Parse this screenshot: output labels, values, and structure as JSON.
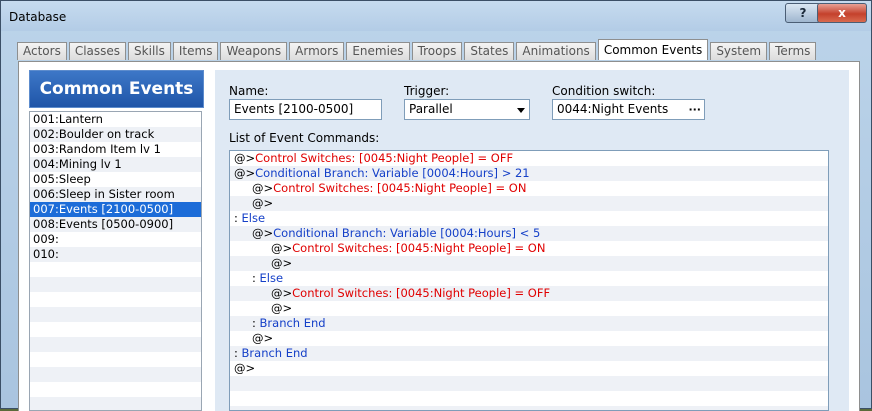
{
  "window": {
    "title": "Database",
    "help_label": "?",
    "close_label": "x"
  },
  "tabs": [
    {
      "label": "Actors"
    },
    {
      "label": "Classes"
    },
    {
      "label": "Skills"
    },
    {
      "label": "Items"
    },
    {
      "label": "Weapons"
    },
    {
      "label": "Armors"
    },
    {
      "label": "Enemies"
    },
    {
      "label": "Troops"
    },
    {
      "label": "States"
    },
    {
      "label": "Animations"
    },
    {
      "label": "Common Events",
      "active": true
    },
    {
      "label": "System"
    },
    {
      "label": "Terms"
    }
  ],
  "sidebar": {
    "header": "Common Events",
    "items": [
      {
        "label": "001:Lantern"
      },
      {
        "label": "002:Boulder on track"
      },
      {
        "label": "003:Random Item lv 1"
      },
      {
        "label": "004:Mining lv 1"
      },
      {
        "label": "005:Sleep"
      },
      {
        "label": "006:Sleep in Sister room"
      },
      {
        "label": "007:Events [2100-0500]",
        "selected": true
      },
      {
        "label": "008:Events [0500-0900]"
      },
      {
        "label": "009:"
      },
      {
        "label": "010:"
      },
      {
        "label": ""
      },
      {
        "label": ""
      },
      {
        "label": ""
      },
      {
        "label": ""
      },
      {
        "label": ""
      },
      {
        "label": ""
      },
      {
        "label": ""
      },
      {
        "label": ""
      },
      {
        "label": ""
      },
      {
        "label": ""
      }
    ]
  },
  "form": {
    "name_label": "Name:",
    "name_value": "Events [2100-0500]",
    "trigger_label": "Trigger:",
    "trigger_value": "Parallel",
    "condition_label": "Condition switch:",
    "condition_value": "0044:Night Events",
    "condition_button": "···",
    "commands_label": "List of Event Commands:"
  },
  "commands": [
    {
      "prefix": "@>",
      "text": "Control Switches: [0045:Night People] = OFF",
      "color": "red",
      "indent": 0
    },
    {
      "prefix": "@>",
      "text": "Conditional Branch: Variable [0004:Hours] > 21",
      "color": "blue",
      "indent": 0
    },
    {
      "prefix": "@>",
      "text": "Control Switches: [0045:Night People] = ON",
      "color": "red",
      "indent": 1
    },
    {
      "prefix": "@>",
      "text": "",
      "color": "black",
      "indent": 1
    },
    {
      "prefix": " : ",
      "text": "Else",
      "color": "blue",
      "indent": 0
    },
    {
      "prefix": "@>",
      "text": "Conditional Branch: Variable [0004:Hours] < 5",
      "color": "blue",
      "indent": 1
    },
    {
      "prefix": "@>",
      "text": "Control Switches: [0045:Night People] = ON",
      "color": "red",
      "indent": 2
    },
    {
      "prefix": "@>",
      "text": "",
      "color": "black",
      "indent": 2
    },
    {
      "prefix": " : ",
      "text": "Else",
      "color": "blue",
      "indent": 1
    },
    {
      "prefix": "@>",
      "text": "Control Switches: [0045:Night People] = OFF",
      "color": "red",
      "indent": 2
    },
    {
      "prefix": "@>",
      "text": "",
      "color": "black",
      "indent": 2
    },
    {
      "prefix": " : ",
      "text": "Branch End",
      "color": "blue",
      "indent": 1
    },
    {
      "prefix": "@>",
      "text": "",
      "color": "black",
      "indent": 1
    },
    {
      "prefix": " : ",
      "text": "Branch End",
      "color": "blue",
      "indent": 0
    },
    {
      "prefix": "@>",
      "text": "",
      "color": "black",
      "indent": 0
    },
    {
      "prefix": "",
      "text": "",
      "color": "black",
      "indent": 0
    },
    {
      "prefix": "",
      "text": "",
      "color": "black",
      "indent": 0
    },
    {
      "prefix": "",
      "text": "",
      "color": "black",
      "indent": 0
    }
  ],
  "colors": {
    "red": "#e00000",
    "blue": "#1540c8",
    "selection": "#1c6cd8",
    "header": "#2a63b8"
  }
}
